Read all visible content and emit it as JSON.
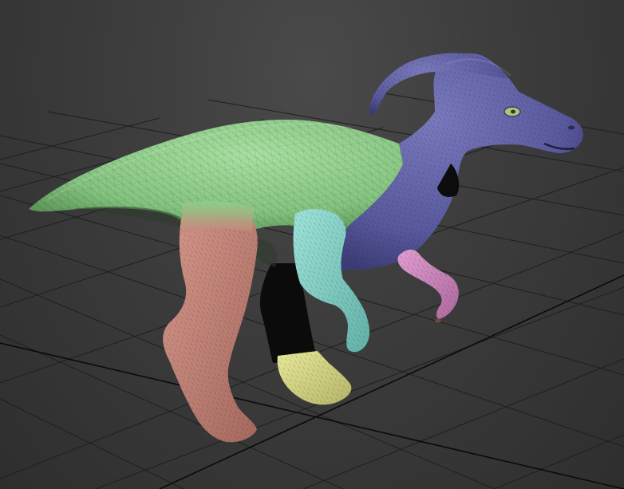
{
  "viewport": {
    "background_color": "#3a3a3a",
    "grid_color": "#1e1e1e",
    "grid_highlight_color": "#000000"
  },
  "model": {
    "element_groups": [
      {
        "name": "tail-and-back",
        "color": "#8fcf8a"
      },
      {
        "name": "head-and-neck",
        "color": "#5f5fa8"
      },
      {
        "name": "hind-leg-right",
        "color": "#c7857a"
      },
      {
        "name": "front-arm-right",
        "color": "#86d6cb"
      },
      {
        "name": "front-arm-left",
        "color": "#d386c2"
      },
      {
        "name": "hind-foot-left",
        "color": "#dada86"
      },
      {
        "name": "hind-leg-left-shadowed",
        "color": "#0a0a0a"
      }
    ]
  }
}
